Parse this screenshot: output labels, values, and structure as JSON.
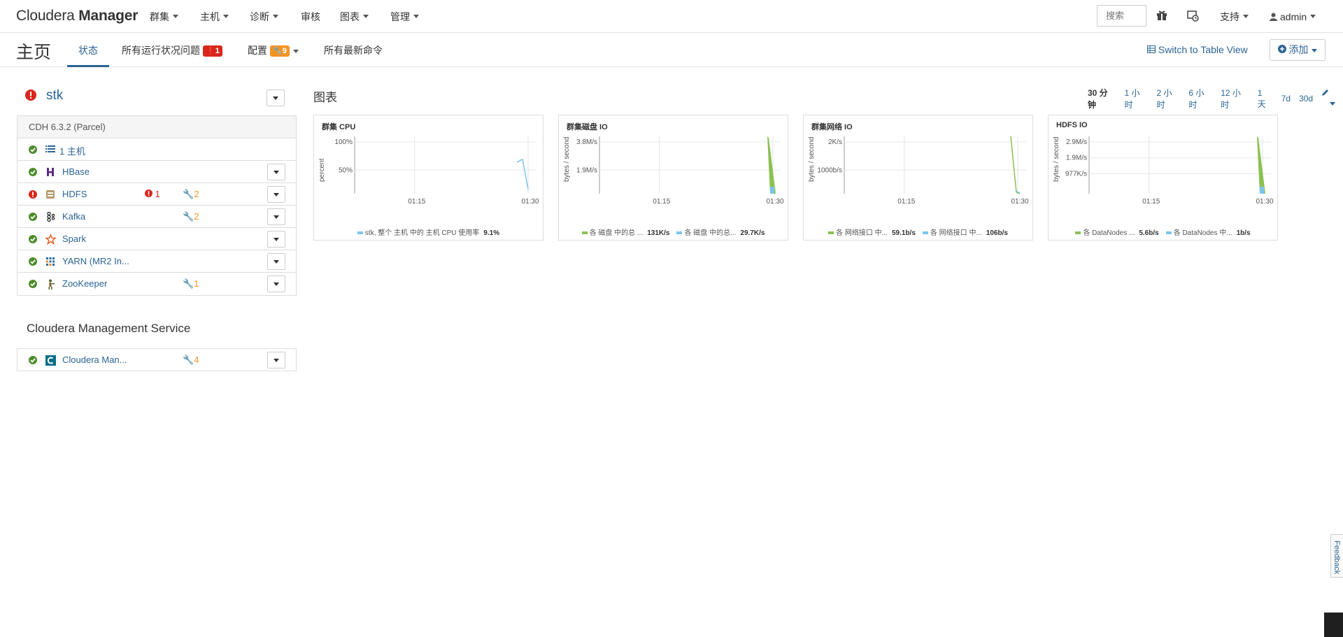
{
  "navbar": {
    "brand_light": "Cloudera",
    "brand_bold": "Manager",
    "menus": [
      "群集",
      "主机",
      "诊断",
      "审核",
      "图表",
      "管理"
    ],
    "search_placeholder": "搜索",
    "support_label": "支持",
    "user_label": "admin"
  },
  "subheader": {
    "title": "主页",
    "tabs": {
      "status": "状态",
      "health": "所有运行状况问题",
      "health_count": "1",
      "config": "配置",
      "config_count": "9",
      "commands": "所有最新命令"
    },
    "table_view_label": "Switch to Table View",
    "add_label": "添加"
  },
  "cluster": {
    "name": "stk",
    "version": "CDH 6.3.2 (Parcel)",
    "hosts_label": "1 主机",
    "services": [
      {
        "name": "HBase",
        "health": "",
        "config": ""
      },
      {
        "name": "HDFS",
        "health": "1",
        "config": "2"
      },
      {
        "name": "Kafka",
        "health": "",
        "config": "2"
      },
      {
        "name": "Spark",
        "health": "",
        "config": ""
      },
      {
        "name": "YARN (MR2 In...",
        "health": "",
        "config": ""
      },
      {
        "name": "ZooKeeper",
        "health": "",
        "config": "1"
      }
    ]
  },
  "mgmt": {
    "title": "Cloudera Management Service",
    "service_name": "Cloudera Man...",
    "config": "4"
  },
  "charts_section": {
    "title": "图表",
    "time_ranges": [
      "30 分钟",
      "1 小时",
      "2 小时",
      "6 小时",
      "12 小时",
      "1 天",
      "7d",
      "30d"
    ],
    "active_range": "30 分钟"
  },
  "colors": {
    "link": "#2a6496",
    "green": "#8cc152",
    "blue": "#7cc4ec",
    "red": "#d9261c",
    "orange": "#f29423"
  },
  "chart_data": [
    {
      "type": "line",
      "title": "群集 CPU",
      "ylabel": "percent",
      "yticks": [
        "100%",
        "50%"
      ],
      "xticks": [
        "01:15",
        "01:30"
      ],
      "series": [
        {
          "name": "stk, 整个 主机 中的 主机 CPU 使用率",
          "current": "9.1%",
          "color": "#7cc4ec",
          "values": [
            55,
            60,
            8
          ]
        }
      ]
    },
    {
      "type": "area",
      "title": "群集磁盘 IO",
      "ylabel": "bytes / second",
      "yticks": [
        "3.8M/s",
        "1.9M/s"
      ],
      "xticks": [
        "01:15",
        "01:30"
      ],
      "series": [
        {
          "name": "各 磁盘 中的总 ...",
          "current": "131K/s",
          "color": "#8cc152"
        },
        {
          "name": "各 磁盘 中的总...",
          "current": "29.7K/s",
          "color": "#7cc4ec"
        }
      ]
    },
    {
      "type": "line",
      "title": "群集网络 IO",
      "ylabel": "bytes / second",
      "yticks": [
        "2K/s",
        "1000b/s"
      ],
      "xticks": [
        "01:15",
        "01:30"
      ],
      "series": [
        {
          "name": "各 网络接口 中...",
          "current": "59.1b/s",
          "color": "#8cc152"
        },
        {
          "name": "各 网络接口 中...",
          "current": "106b/s",
          "color": "#7cc4ec"
        }
      ]
    },
    {
      "type": "area",
      "title": "HDFS IO",
      "ylabel": "bytes / second",
      "yticks": [
        "2.9M/s",
        "1.9M/s",
        "977K/s"
      ],
      "xticks": [
        "01:15",
        "01:30"
      ],
      "series": [
        {
          "name": "各 DataNodes ...",
          "current": "5.6b/s",
          "color": "#8cc152"
        },
        {
          "name": "各 DataNodes 中...",
          "current": "1b/s",
          "color": "#7cc4ec"
        }
      ]
    }
  ]
}
